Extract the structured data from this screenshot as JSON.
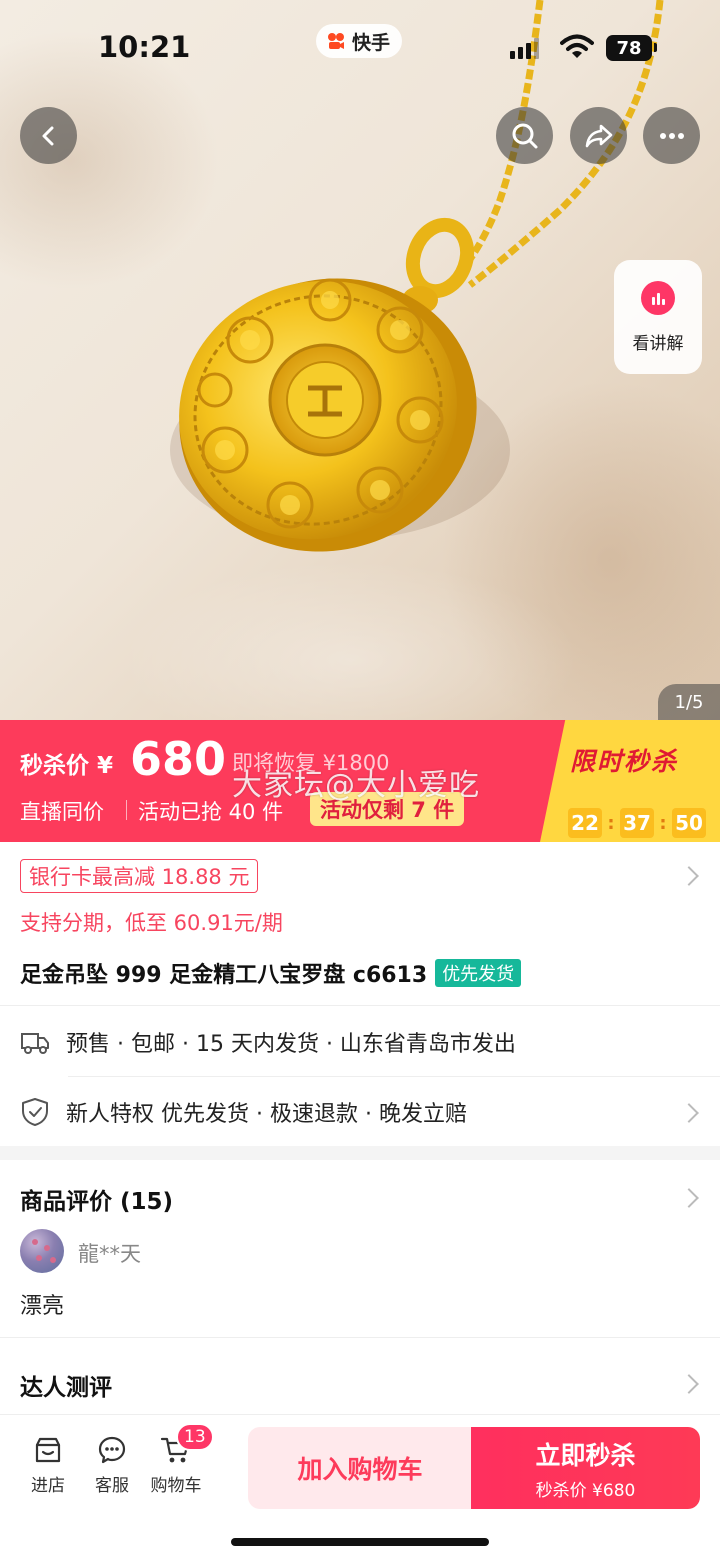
{
  "status": {
    "time": "10:21",
    "app_name": "快手",
    "battery": "78"
  },
  "hero": {
    "pager": "1/5",
    "explain_label": "看讲解"
  },
  "flash": {
    "tag": "秒杀价",
    "currency": "¥",
    "price": "680",
    "original": "即将恢复 ¥1800",
    "live_same": "直播同价",
    "sold": "活动已抢 40 件",
    "remaining": "活动仅剩 7 件",
    "title": "限时秒杀",
    "timer": [
      "22",
      "37",
      "50"
    ],
    "watermark": "大家坛@大小爱吃"
  },
  "info": {
    "coupon": "银行卡最高减 18.88 元",
    "installment": "支持分期，低至 60.91元/期",
    "title": "足金吊坠 999 足金精工八宝罗盘 c6613",
    "priority_badge": "优先发货",
    "shipping": "预售 · 包邮 · 15 天内发货 · 山东省青岛市发出",
    "privileges": "新人特权 优先发货 · 极速退款 · 晚发立赔"
  },
  "reviews": {
    "heading": "商品评价 (15)",
    "user": "龍**天",
    "text": "漂亮",
    "kol_heading": "达人测评"
  },
  "bottom_bar": {
    "store": "进店",
    "service": "客服",
    "cart": "购物车",
    "cart_count": "13",
    "add_to_cart": "加入购物车",
    "buy_now": "立即秒杀",
    "buy_now_sub": "秒杀价 ¥680"
  },
  "colors": {
    "accent": "#fd3b5b",
    "flash_yellow": "#ffd740",
    "badge_green": "#16b89a"
  },
  "icons": [
    "back-icon",
    "search-icon",
    "share-icon",
    "more-icon",
    "truck-icon",
    "shield-icon",
    "store-icon",
    "service-icon",
    "cart-icon"
  ]
}
